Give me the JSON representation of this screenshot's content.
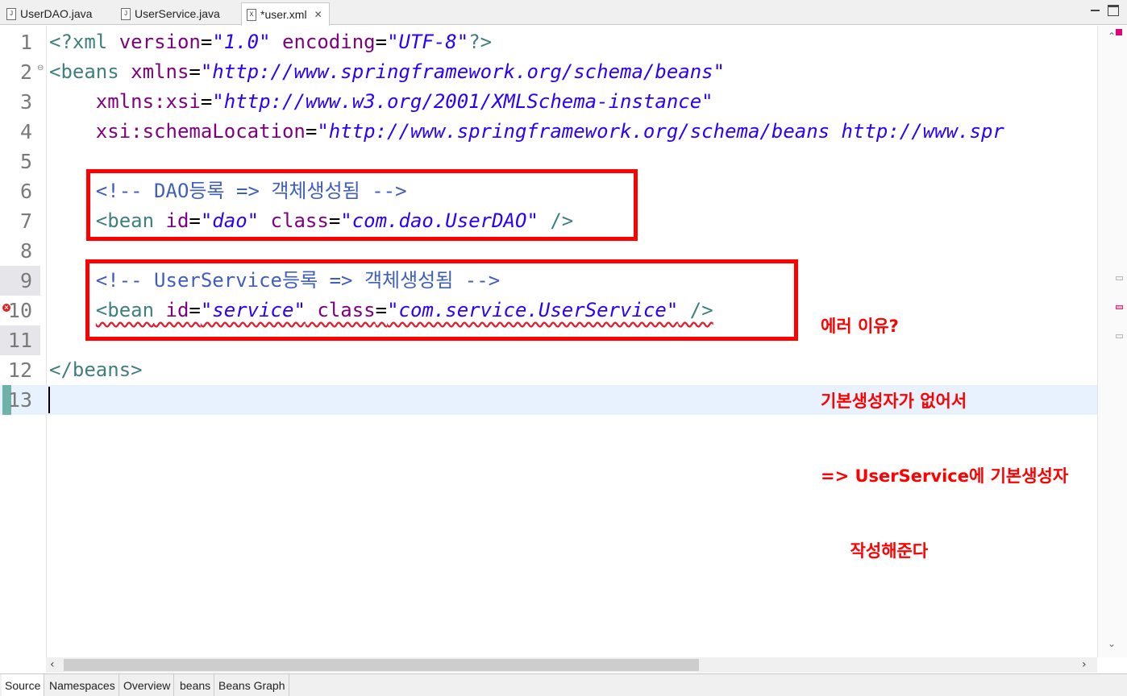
{
  "tabs": [
    {
      "label": "UserDAO.java",
      "icon": "java-file-icon",
      "active": false
    },
    {
      "label": "UserService.java",
      "icon": "java-file-icon",
      "active": false
    },
    {
      "label": "*user.xml",
      "icon": "xml-file-icon",
      "active": true
    }
  ],
  "editor": {
    "line_numbers": [
      "1",
      "2",
      "3",
      "4",
      "5",
      "6",
      "7",
      "8",
      "9",
      "10",
      "11",
      "12",
      "13"
    ],
    "lines": {
      "l1": {
        "lt": "<?",
        "kw": "xml",
        "a1": " version",
        "eq1": "=",
        "v1": "\"1.0\"",
        "a2": " encoding",
        "eq2": "=",
        "v2": "\"UTF-8\"",
        "end": "?>"
      },
      "l2": {
        "open": "<beans",
        "a1": " xmlns",
        "eq1": "=",
        "v1": "\"http://www.springframework.org/schema/beans\""
      },
      "l3": {
        "indent": "    ",
        "a1": "xmlns:xsi",
        "eq1": "=",
        "v1": "\"http://www.w3.org/2001/XMLSchema-instance\""
      },
      "l4": {
        "indent": "    ",
        "a1": "xsi:schemaLocation",
        "eq1": "=",
        "v1": "\"http://www.springframework.org/schema/beans http://www.spr"
      },
      "l6": {
        "indent": "    ",
        "comment": "<!-- DAO등록 => 객체생성됨 -->"
      },
      "l7": {
        "indent": "    ",
        "open": "<bean",
        "a1": " id",
        "eq1": "=",
        "v1": "\"dao\"",
        "a2": " class",
        "eq2": "=",
        "v2": "\"com.dao.UserDAO\"",
        "end": " />"
      },
      "l9": {
        "indent": "    ",
        "comment": "<!-- UserService등록 => 객체생성됨 -->"
      },
      "l10": {
        "indent": "    ",
        "open": "<bean",
        "a1": " id",
        "eq1": "=",
        "v1": "\"service\"",
        "a2": " class",
        "eq2": "=",
        "v2": "\"com.service.UserService\"",
        "end": " />"
      },
      "l12": {
        "close": "</beans>"
      }
    }
  },
  "annotation": {
    "lines": [
      "에러 이유?",
      "기본생성자가 없어서",
      "=> UserService에 기본생성자",
      "     작성해준다"
    ],
    "color": "#ff0000"
  },
  "page_tabs": [
    {
      "label": "Source",
      "active": true
    },
    {
      "label": "Namespaces",
      "active": false
    },
    {
      "label": "Overview",
      "active": false
    },
    {
      "label": "beans",
      "active": false
    },
    {
      "label": "Beans Graph",
      "active": false
    }
  ],
  "colors": {
    "tag": "#3f7f7f",
    "attribute": "#7f007f",
    "string": "#2a00ff",
    "comment": "#3f5fbf",
    "highlight_box": "#ff0000",
    "current_line": "#e8f2fe"
  }
}
